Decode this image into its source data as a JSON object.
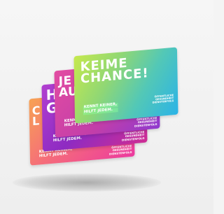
{
  "cards": [
    {
      "headline_lines": [
        "C",
        "L"
      ],
      "slogan_lines": [
        "KENNT KEINER,",
        "HILFT JEDEM."
      ],
      "signature_lines": [
        "ÖFFENTLICHE",
        "GESUNDHEIT",
        "DIENSTERFOLG"
      ]
    },
    {
      "headline_lines": [
        "H",
        "G"
      ],
      "slogan_lines": [
        "KENNT KEINER,",
        "HILFT JEDEM."
      ],
      "signature_lines": [
        "ÖFFENTLICHE",
        "GESUNDHEIT",
        "DIENSTERFOLG"
      ]
    },
    {
      "headline_lines": [
        "JE",
        "AU"
      ],
      "slogan_lines": [
        "KENNT KEINER,",
        "HILFT JEDEM."
      ],
      "signature_lines": [
        "ÖFFENTLICHE",
        "GESUNDHEIT",
        "DIENSTERFOLG"
      ]
    },
    {
      "headline_lines": [
        "KEIME",
        "CHANCE!"
      ],
      "slogan_lines": [
        "KENNT KEINER,",
        "HILFT JEDEM."
      ],
      "signature_lines": [
        "ÖFFENTLICHE",
        "GESUNDHEIT",
        "DIENSTERFOLG"
      ]
    }
  ],
  "colors": {
    "background": "#f4f4f4",
    "front_card_start": "#c6e94d",
    "front_card_end": "#2bb3e7",
    "pink": "#ec3a9f",
    "purple": "#8e2bc2",
    "orange": "#f7a253"
  }
}
